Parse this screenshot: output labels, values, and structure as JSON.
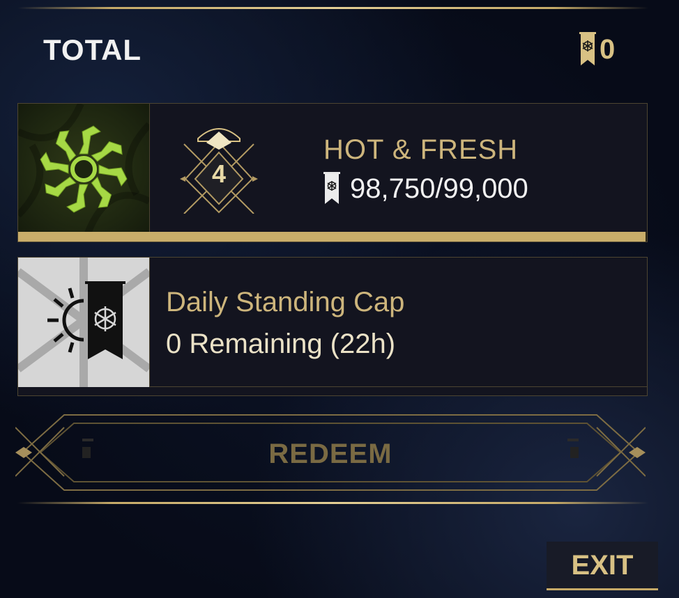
{
  "total": {
    "label": "TOTAL",
    "value": "0",
    "icon": "standing-banner-icon"
  },
  "faction": {
    "name": "HOT & FRESH",
    "rank": "4",
    "progress_text": "98,750/99,000",
    "progress_fraction": 0.9975,
    "emblem_icon": "green-sigil-icon",
    "progress_icon": "standing-banner-icon"
  },
  "daily_cap": {
    "title": "Daily Standing Cap",
    "remaining": "0 Remaining (22h)",
    "icon": "daily-cap-banner-icon"
  },
  "buttons": {
    "redeem": "REDEEM",
    "exit": "EXIT"
  },
  "colors": {
    "accent_gold": "#c8ad6a",
    "text_gold": "#cdb57c",
    "emblem_green": "#a6d945",
    "panel_bg": "#13141f"
  }
}
